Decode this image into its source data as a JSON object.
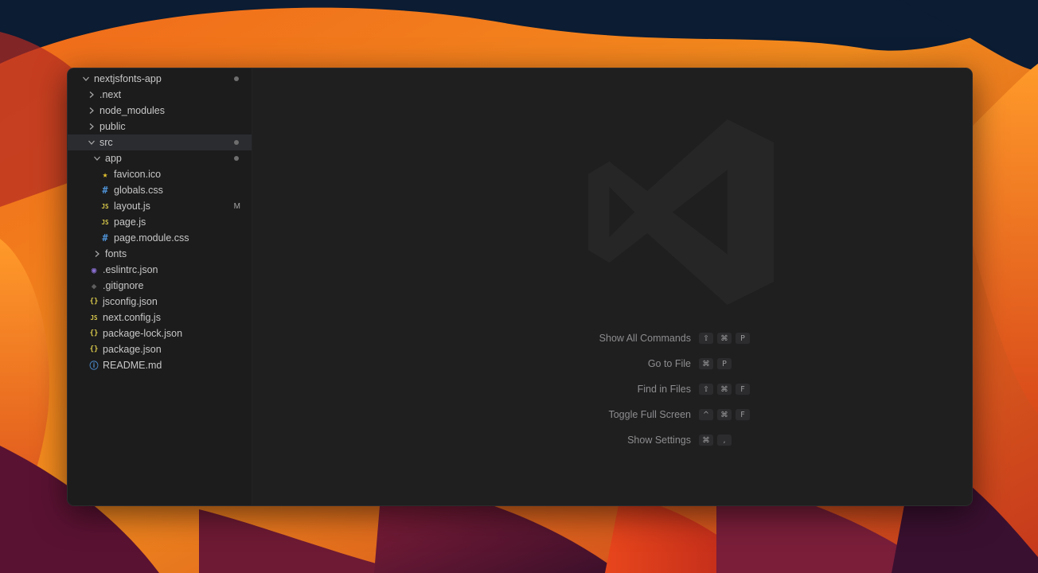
{
  "explorer": {
    "items": [
      {
        "label": "nextjsfonts-app",
        "kind": "folder-open",
        "depth": 0,
        "dot": true
      },
      {
        "label": ".next",
        "kind": "folder",
        "depth": 1
      },
      {
        "label": "node_modules",
        "kind": "folder",
        "depth": 1
      },
      {
        "label": "public",
        "kind": "folder",
        "depth": 1
      },
      {
        "label": "src",
        "kind": "folder-open",
        "depth": 1,
        "dot": true,
        "selected": true
      },
      {
        "label": "app",
        "kind": "folder-open",
        "depth": 2,
        "dot": true
      },
      {
        "label": "favicon.ico",
        "kind": "file",
        "icon": "star-icon",
        "glyph": "★",
        "color": "#e2c12f",
        "depth": 3
      },
      {
        "label": "globals.css",
        "kind": "file",
        "icon": "css-hash-icon",
        "glyph": "#",
        "color": "#4d8fd1",
        "depth": 3
      },
      {
        "label": "layout.js",
        "kind": "file",
        "icon": "js-icon",
        "glyph": "JS",
        "color": "#d8c84a",
        "depth": 3,
        "badge": "M"
      },
      {
        "label": "page.js",
        "kind": "file",
        "icon": "js-icon",
        "glyph": "JS",
        "color": "#d8c84a",
        "depth": 3
      },
      {
        "label": "page.module.css",
        "kind": "file",
        "icon": "css-hash-icon",
        "glyph": "#",
        "color": "#4d8fd1",
        "depth": 3
      },
      {
        "label": "fonts",
        "kind": "folder",
        "depth": 2
      },
      {
        "label": ".eslintrc.json",
        "kind": "file",
        "icon": "eslint-icon",
        "glyph": "◉",
        "color": "#8a6fd1",
        "depth": 1
      },
      {
        "label": ".gitignore",
        "kind": "file",
        "icon": "git-icon",
        "glyph": "◆",
        "color": "#5e5e5e",
        "depth": 1
      },
      {
        "label": "jsconfig.json",
        "kind": "file",
        "icon": "json-braces-icon",
        "glyph": "{}",
        "color": "#d8c84a",
        "depth": 1
      },
      {
        "label": "next.config.js",
        "kind": "file",
        "icon": "js-icon",
        "glyph": "JS",
        "color": "#d8c84a",
        "depth": 1
      },
      {
        "label": "package-lock.json",
        "kind": "file",
        "icon": "json-braces-icon",
        "glyph": "{}",
        "color": "#d8c84a",
        "depth": 1
      },
      {
        "label": "package.json",
        "kind": "file",
        "icon": "json-braces-icon",
        "glyph": "{}",
        "color": "#d8c84a",
        "depth": 1
      },
      {
        "label": "README.md",
        "kind": "file",
        "icon": "info-icon",
        "glyph": "ⓘ",
        "color": "#4d8fd1",
        "depth": 1
      }
    ]
  },
  "shortcuts": [
    {
      "label": "Show All Commands",
      "keys": [
        "⇧",
        "⌘",
        "P"
      ]
    },
    {
      "label": "Go to File",
      "keys": [
        "⌘",
        "P"
      ]
    },
    {
      "label": "Find in Files",
      "keys": [
        "⇧",
        "⌘",
        "F"
      ]
    },
    {
      "label": "Toggle Full Screen",
      "keys": [
        "^",
        "⌘",
        "F"
      ]
    },
    {
      "label": "Show Settings",
      "keys": [
        "⌘",
        ","
      ]
    }
  ],
  "colors": {
    "window_bg": "#1e1e1f",
    "sidebar_bg": "#1c1c1d",
    "selection": "#2a2c30",
    "watermark": "#262627"
  }
}
